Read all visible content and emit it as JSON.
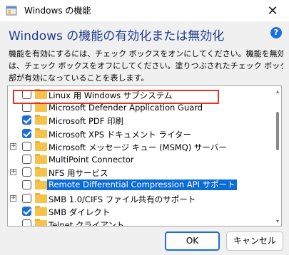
{
  "window": {
    "title": "Windows の機能",
    "heading": "Windows の機能の有効化または無効化",
    "help": "?",
    "close_glyph": "✕"
  },
  "description": [
    "機能を有効にするには、チェック ボックスをオンにしてください。機能を無効にするに",
    "は、チェック ボックスをオフにしてください。塗りつぶされたチェック ボックスは、機能の一",
    "部が有効になっていることを表します。"
  ],
  "features": [
    {
      "label": "Linux 用 Windows サブシステム",
      "checked": false,
      "expandable": false,
      "selected": false
    },
    {
      "label": "Microsoft Defender Application Guard",
      "checked": false,
      "expandable": false,
      "selected": false
    },
    {
      "label": "Microsoft PDF 印刷",
      "checked": true,
      "expandable": false,
      "selected": false
    },
    {
      "label": "Microsoft XPS ドキュメント ライター",
      "checked": true,
      "expandable": false,
      "selected": false
    },
    {
      "label": "Microsoft メッセージ キュー (MSMQ) サーバー",
      "checked": false,
      "expandable": true,
      "selected": false
    },
    {
      "label": "MultiPoint Connector",
      "checked": false,
      "expandable": false,
      "selected": false
    },
    {
      "label": "NFS 用サービス",
      "checked": false,
      "expandable": true,
      "selected": false
    },
    {
      "label": "Remote Differential Compression API サポート",
      "checked": false,
      "expandable": false,
      "selected": true
    },
    {
      "label": "SMB 1.0/CIFS ファイル共有のサポート",
      "checked": false,
      "expandable": true,
      "selected": false
    },
    {
      "label": "SMB ダイレクト",
      "checked": true,
      "expandable": false,
      "selected": false
    },
    {
      "label": "Telnet クライアント",
      "checked": false,
      "expandable": false,
      "selected": false
    }
  ],
  "buttons": {
    "ok": "OK",
    "cancel": "キャンセル"
  },
  "colors": {
    "heading": "#1e3c8c",
    "accent": "#1f6fd1",
    "selection": "#0a6cd6",
    "highlight_box": "#e0312b",
    "folder": "#f5c34b"
  },
  "icons": {
    "app": "windows-features-icon",
    "help": "help-icon",
    "folder": "folder-icon",
    "expander": "plus-expander-icon"
  }
}
